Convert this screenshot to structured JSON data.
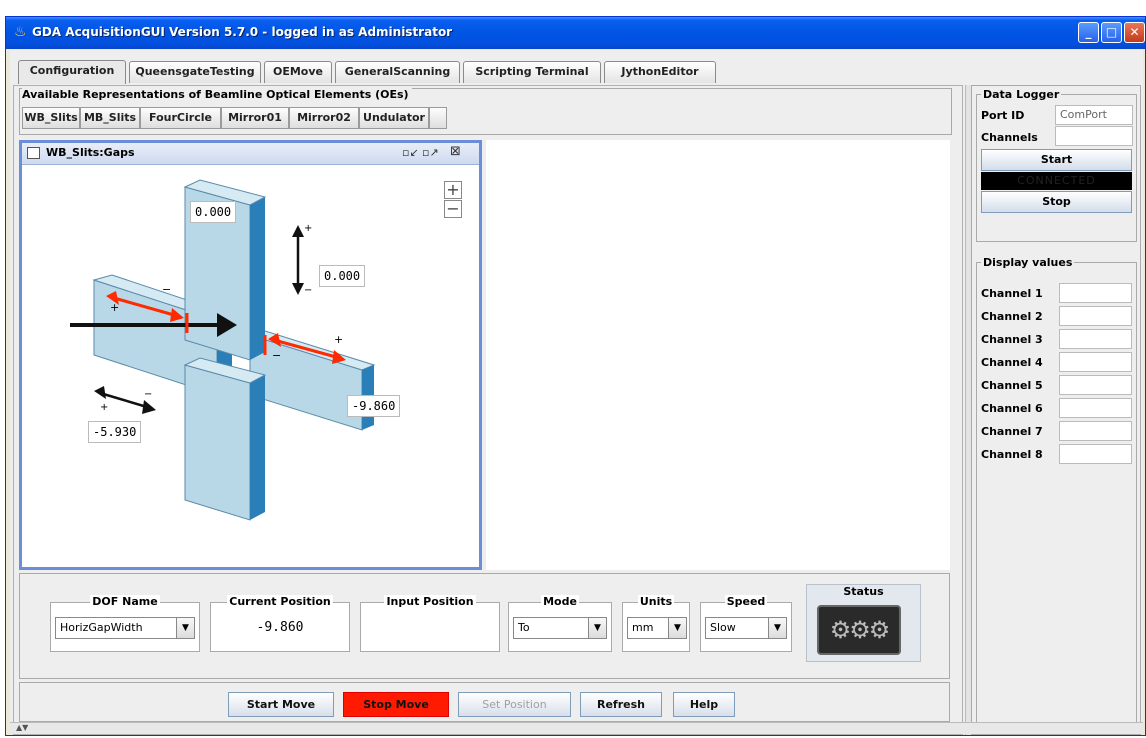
{
  "window": {
    "title": "GDA AcquisitionGUI Version 5.7.0 - logged in as Administrator"
  },
  "tabs": [
    {
      "label": "Configuration"
    },
    {
      "label": "QueensgateTesting"
    },
    {
      "label": "OEMove"
    },
    {
      "label": "GeneralScanning"
    },
    {
      "label": "Scripting Terminal"
    },
    {
      "label": "JythonEditor"
    }
  ],
  "oe": {
    "title": "Available Representations of Beamline Optical Elements (OEs)",
    "buttons": [
      "WB_Slits",
      "MB_Slits",
      "FourCircle",
      "Mirror01",
      "Mirror02",
      "Undulator"
    ]
  },
  "frame": {
    "title": "WB_Slits:Gaps",
    "values": {
      "top": "0.000",
      "vertical": "0.000",
      "right": "-9.860",
      "left": "-5.930"
    }
  },
  "controls": {
    "dof_name": {
      "label": "DOF Name",
      "value": "HorizGapWidth"
    },
    "current_position": {
      "label": "Current Position",
      "value": "-9.860"
    },
    "input_position": {
      "label": "Input Position",
      "value": ""
    },
    "mode": {
      "label": "Mode",
      "value": "To"
    },
    "units": {
      "label": "Units",
      "value": "mm"
    },
    "speed": {
      "label": "Speed",
      "value": "Slow"
    },
    "status": {
      "label": "Status"
    }
  },
  "actions": {
    "start_move": "Start Move",
    "stop_move": "Stop Move",
    "set_position": "Set Position",
    "refresh": "Refresh",
    "help": "Help"
  },
  "data_logger": {
    "title": "Data Logger",
    "port_label": "Port ID",
    "port_value": "ComPort",
    "channels_label": "Channels",
    "start": "Start",
    "connected": "CONNECTED",
    "stop": "Stop"
  },
  "display_values": {
    "title": "Display values",
    "channels": [
      "Channel 1",
      "Channel 2",
      "Channel 3",
      "Channel 4",
      "Channel 5",
      "Channel 6",
      "Channel 7",
      "Channel 8"
    ]
  },
  "colors": {
    "stop_button": "#ff1a00",
    "titlebar": "#0054e3",
    "slit_face": "#b8d8e8",
    "slit_edge": "#2a7fb8",
    "arrow_red": "#ff2a00"
  }
}
